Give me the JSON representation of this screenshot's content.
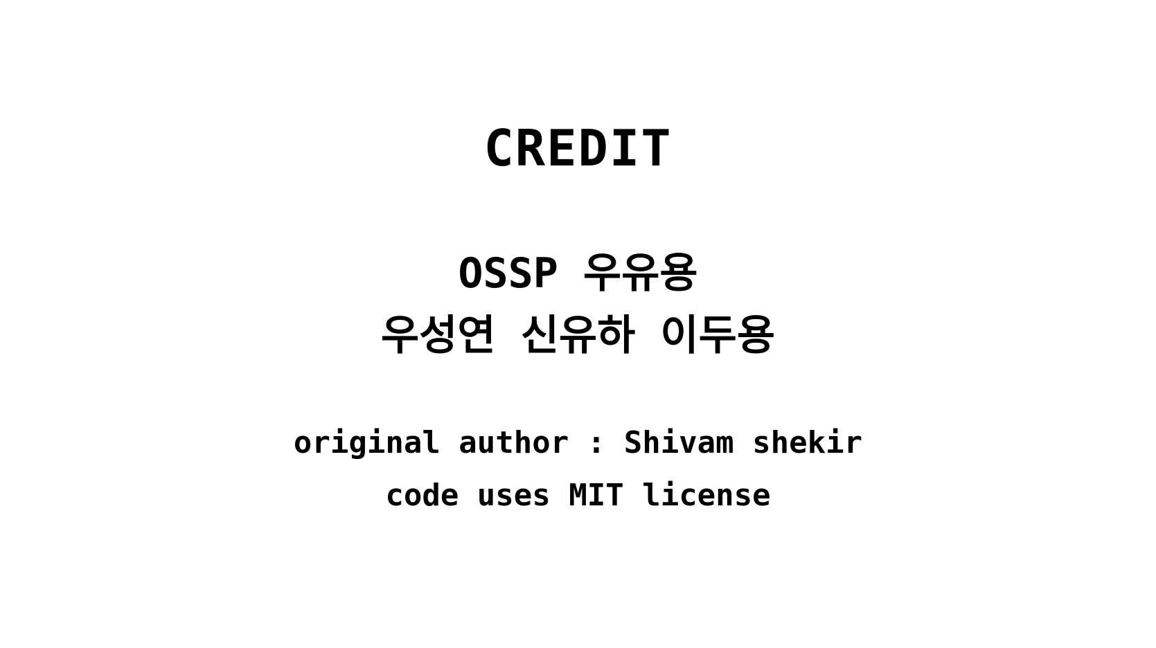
{
  "credits": {
    "title": "CREDIT",
    "team": "OSSP 우유용",
    "members": "우성연 신유하 이두용",
    "author": "original author : Shivam shekir",
    "license": "code uses MIT license"
  },
  "colors": {
    "background": "#ffffff",
    "text": "#000000"
  }
}
